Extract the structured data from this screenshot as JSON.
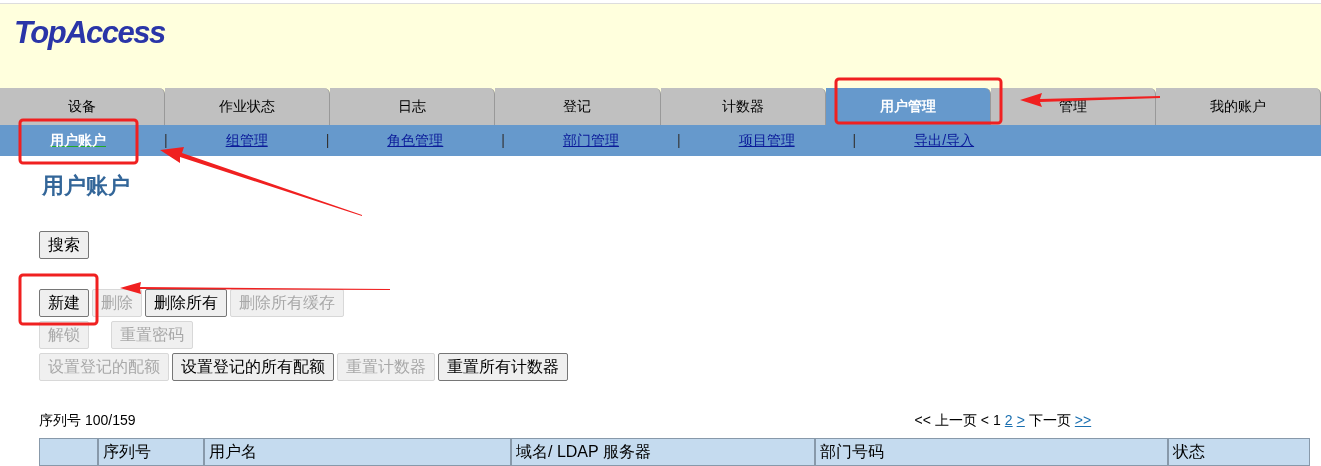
{
  "header": {
    "logo": "TopAccess"
  },
  "tabs": [
    {
      "label": "设备",
      "selected": false
    },
    {
      "label": "作业状态",
      "selected": false
    },
    {
      "label": "日志",
      "selected": false
    },
    {
      "label": "登记",
      "selected": false
    },
    {
      "label": "计数器",
      "selected": false
    },
    {
      "label": "用户管理",
      "selected": true
    },
    {
      "label": "管理",
      "selected": false
    },
    {
      "label": "我的账户",
      "selected": false
    }
  ],
  "subnav": [
    {
      "label": "用户账户",
      "selected": true
    },
    {
      "label": "组管理",
      "selected": false
    },
    {
      "label": "角色管理",
      "selected": false
    },
    {
      "label": "部门管理",
      "selected": false
    },
    {
      "label": "项目管理",
      "selected": false
    },
    {
      "label": "导出/导入",
      "selected": false
    }
  ],
  "page_title": "用户账户",
  "subnav_separator": "|",
  "search_button": {
    "label": "搜索",
    "disabled": false
  },
  "button_rows": [
    [
      {
        "label": "新建",
        "disabled": false
      },
      {
        "label": "删除",
        "disabled": true
      },
      {
        "label": "删除所有",
        "disabled": false
      },
      {
        "label": "删除所有缓存",
        "disabled": true
      }
    ],
    [
      {
        "label": "解锁",
        "disabled": true
      },
      {
        "label": "重置密码",
        "disabled": true
      }
    ],
    [
      {
        "label": "设置登记的配额",
        "disabled": true
      },
      {
        "label": "设置登记的所有配额",
        "disabled": false
      },
      {
        "label": "重置计数器",
        "disabled": true
      },
      {
        "label": "重置所有计数器",
        "disabled": false
      }
    ]
  ],
  "record_count": "序列号 100/159",
  "pagination": [
    {
      "text": "<<",
      "link": false
    },
    {
      "text": "上一页",
      "link": false
    },
    {
      "text": "<",
      "link": false
    },
    {
      "text": "1",
      "link": false
    },
    {
      "text": "2",
      "link": true
    },
    {
      "text": ">",
      "link": true
    },
    {
      "text": "下一页",
      "link": false
    },
    {
      "text": ">>",
      "link": true
    }
  ],
  "table": {
    "columns": [
      "",
      "序列号",
      "用户名",
      "域名/ LDAP 服务器",
      "部门号码",
      "状态"
    ]
  }
}
